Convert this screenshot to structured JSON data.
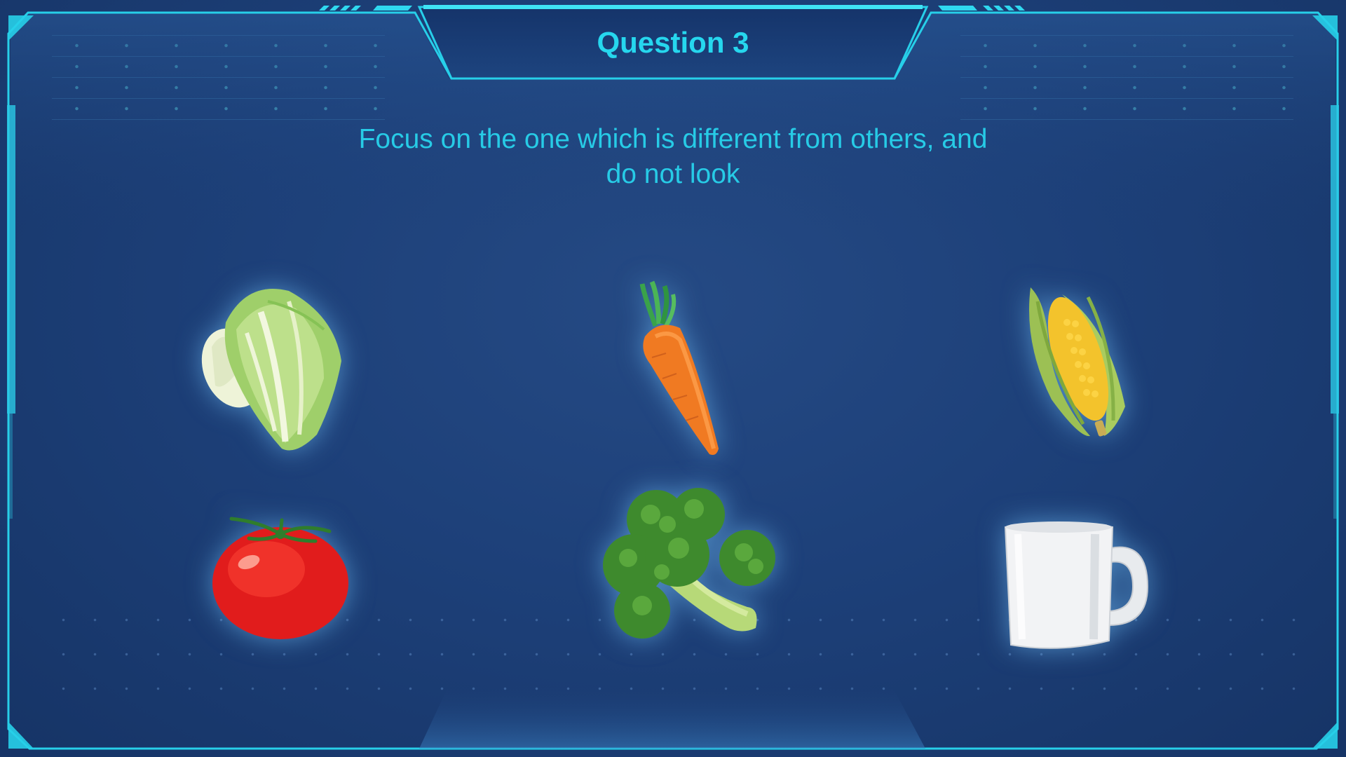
{
  "quiz": {
    "title": "Question 3",
    "instruction_line1": "Focus on the one which is different from others, and",
    "instruction_line2": "do not look"
  },
  "options": [
    {
      "icon": "napa-cabbage-icon",
      "kind": "vegetable"
    },
    {
      "icon": "carrot-icon",
      "kind": "vegetable"
    },
    {
      "icon": "corn-icon",
      "kind": "vegetable"
    },
    {
      "icon": "tomato-icon",
      "kind": "vegetable"
    },
    {
      "icon": "broccoli-icon",
      "kind": "vegetable"
    },
    {
      "icon": "white-mug-icon",
      "kind": "object"
    }
  ],
  "theme": {
    "background": "#1d4079",
    "frame_accent": "#27d5ee",
    "title_color": "#26d7ee"
  }
}
